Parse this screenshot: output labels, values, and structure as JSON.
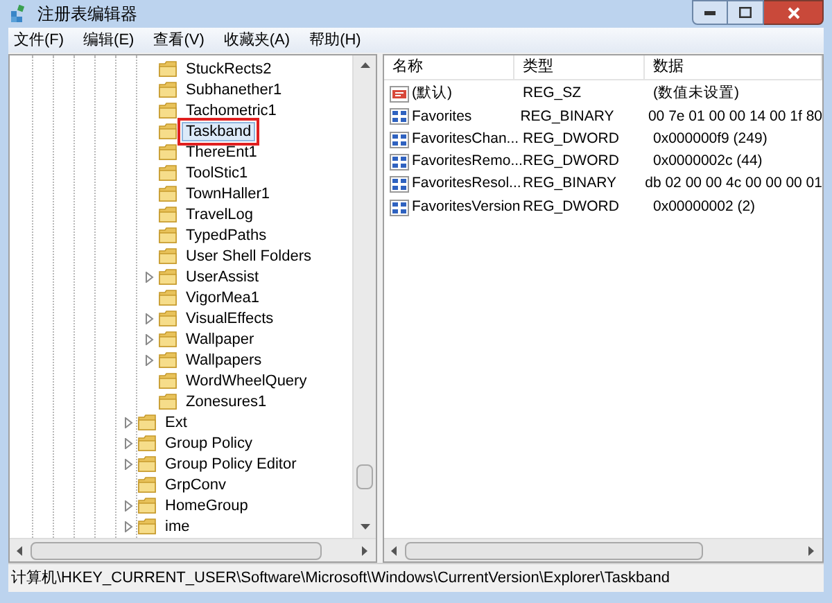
{
  "window": {
    "title": "注册表编辑器"
  },
  "menu": [
    "文件(F)",
    "编辑(E)",
    "查看(V)",
    "收藏夹(A)",
    "帮助(H)"
  ],
  "tree": {
    "children_of_parent": [
      {
        "label": "StuckRects2",
        "expandable": false,
        "selected": false
      },
      {
        "label": "Subhanether1",
        "expandable": false,
        "selected": false
      },
      {
        "label": "Tachometric1",
        "expandable": false,
        "selected": false
      },
      {
        "label": "Taskband",
        "expandable": false,
        "selected": true
      },
      {
        "label": "ThereEnt1",
        "expandable": false,
        "selected": false
      },
      {
        "label": "ToolStic1",
        "expandable": false,
        "selected": false
      },
      {
        "label": "TownHaller1",
        "expandable": false,
        "selected": false
      },
      {
        "label": "TravelLog",
        "expandable": false,
        "selected": false
      },
      {
        "label": "TypedPaths",
        "expandable": false,
        "selected": false
      },
      {
        "label": "User Shell Folders",
        "expandable": false,
        "selected": false
      },
      {
        "label": "UserAssist",
        "expandable": true,
        "selected": false
      },
      {
        "label": "VigorMea1",
        "expandable": false,
        "selected": false
      },
      {
        "label": "VisualEffects",
        "expandable": true,
        "selected": false
      },
      {
        "label": "Wallpaper",
        "expandable": true,
        "selected": false
      },
      {
        "label": "Wallpapers",
        "expandable": true,
        "selected": false
      },
      {
        "label": "WordWheelQuery",
        "expandable": false,
        "selected": false
      },
      {
        "label": "Zonesures1",
        "expandable": false,
        "selected": false
      }
    ],
    "items": [
      {
        "label": "Ext",
        "expandable": true,
        "selected": false
      },
      {
        "label": "Group Policy",
        "expandable": true,
        "selected": false
      },
      {
        "label": "Group Policy Editor",
        "expandable": true,
        "selected": false
      },
      {
        "label": "GrpConv",
        "expandable": false,
        "selected": false
      },
      {
        "label": "HomeGroup",
        "expandable": true,
        "selected": false
      },
      {
        "label": "ime",
        "expandable": true,
        "selected": false
      }
    ]
  },
  "table": {
    "columns": [
      "名称",
      "类型",
      "数据"
    ],
    "rows": [
      {
        "kind": "string",
        "name": "(默认)",
        "type": "REG_SZ",
        "data": "(数值未设置)"
      },
      {
        "kind": "binary",
        "name": "Favorites",
        "type": "REG_BINARY",
        "data": "00 7e 01 00 00 14 00 1f 80"
      },
      {
        "kind": "binary",
        "name": "FavoritesChan...",
        "type": "REG_DWORD",
        "data": "0x000000f9 (249)"
      },
      {
        "kind": "binary",
        "name": "FavoritesRemo...",
        "type": "REG_DWORD",
        "data": "0x0000002c (44)"
      },
      {
        "kind": "binary",
        "name": "FavoritesResol...",
        "type": "REG_BINARY",
        "data": "db 02 00 00 4c 00 00 00 01"
      },
      {
        "kind": "binary",
        "name": "FavoritesVersion",
        "type": "REG_DWORD",
        "data": "0x00000002 (2)"
      }
    ]
  },
  "status_bar": "计算机\\HKEY_CURRENT_USER\\Software\\Microsoft\\Windows\\CurrentVersion\\Explorer\\Taskband"
}
